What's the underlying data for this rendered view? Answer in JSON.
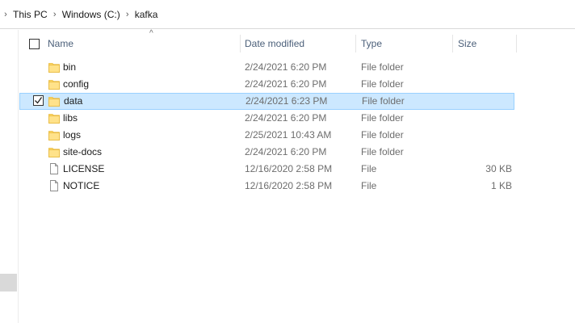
{
  "breadcrumb": {
    "items": [
      "This PC",
      "Windows (C:)",
      "kafka"
    ]
  },
  "columns": {
    "name": "Name",
    "date_modified": "Date modified",
    "type": "Type",
    "size": "Size",
    "sort_indicator": "^"
  },
  "files": [
    {
      "name": "bin",
      "date": "2/24/2021 6:20 PM",
      "type": "File folder",
      "size": "",
      "icon": "folder-icon",
      "selected": false
    },
    {
      "name": "config",
      "date": "2/24/2021 6:20 PM",
      "type": "File folder",
      "size": "",
      "icon": "folder-icon",
      "selected": false
    },
    {
      "name": "data",
      "date": "2/24/2021 6:23 PM",
      "type": "File folder",
      "size": "",
      "icon": "folder-icon",
      "selected": true
    },
    {
      "name": "libs",
      "date": "2/24/2021 6:20 PM",
      "type": "File folder",
      "size": "",
      "icon": "folder-icon",
      "selected": false
    },
    {
      "name": "logs",
      "date": "2/25/2021 10:43 AM",
      "type": "File folder",
      "size": "",
      "icon": "folder-icon",
      "selected": false
    },
    {
      "name": "site-docs",
      "date": "2/24/2021 6:20 PM",
      "type": "File folder",
      "size": "",
      "icon": "folder-icon",
      "selected": false
    },
    {
      "name": "LICENSE",
      "date": "12/16/2020 2:58 PM",
      "type": "File",
      "size": "30 KB",
      "icon": "file-icon",
      "selected": false
    },
    {
      "name": "NOTICE",
      "date": "12/16/2020 2:58 PM",
      "type": "File",
      "size": "1 KB",
      "icon": "file-icon",
      "selected": false
    }
  ],
  "colors": {
    "selection_bg": "#cce8ff",
    "selection_border": "#99d1ff",
    "folder": "#ffd866",
    "header_text": "#4c607a"
  }
}
